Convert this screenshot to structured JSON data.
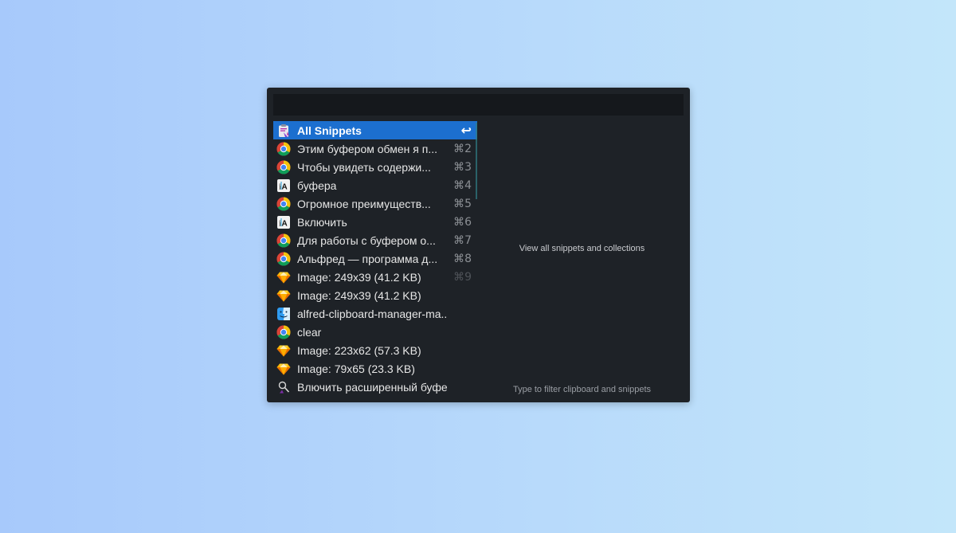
{
  "search": {
    "value": "",
    "placeholder": ""
  },
  "results": [
    {
      "label": "All Snippets",
      "shortcut": "↩",
      "icon": "snippets-clipboard-icon",
      "selected": true
    },
    {
      "label": "Этим буфером обмен я п...",
      "shortcut": "⌘2",
      "icon": "chrome-icon"
    },
    {
      "label": "Чтобы увидеть содержи...",
      "shortcut": "⌘3",
      "icon": "chrome-icon"
    },
    {
      "label": "буфера",
      "shortcut": "⌘4",
      "icon": "ia-writer-icon"
    },
    {
      "label": "Огромное преимуществ...",
      "shortcut": "⌘5",
      "icon": "chrome-icon"
    },
    {
      "label": "Включить",
      "shortcut": "⌘6",
      "icon": "ia-writer-icon"
    },
    {
      "label": "Для работы с буфером о...",
      "shortcut": "⌘7",
      "icon": "chrome-icon"
    },
    {
      "label": "Альфред — программа д...",
      "shortcut": "⌘8",
      "icon": "chrome-icon"
    },
    {
      "label": "Image: 249x39 (41.2 KB)",
      "shortcut": "⌘9",
      "icon": "sketch-icon"
    },
    {
      "label": "Image: 249x39 (41.2 KB)",
      "shortcut": "",
      "icon": "sketch-icon"
    },
    {
      "label": "alfred-clipboard-manager-ma...",
      "shortcut": "",
      "icon": "finder-icon"
    },
    {
      "label": "clear",
      "shortcut": "",
      "icon": "chrome-icon"
    },
    {
      "label": "Image: 223x62 (57.3 KB)",
      "shortcut": "",
      "icon": "sketch-icon"
    },
    {
      "label": "Image: 79x65 (23.3 KB)",
      "shortcut": "",
      "icon": "sketch-icon"
    },
    {
      "label": "Влючить расширенный буфе...",
      "shortcut": "",
      "icon": "alfred-hat-icon"
    }
  ],
  "preview": {
    "description": "View all snippets and collections",
    "hint": "Type to filter clipboard and snippets"
  },
  "colors": {
    "window_bg": "#1e2227",
    "search_bg": "#15181c",
    "selection": "#1c6fcf",
    "text": "#e6e6e6"
  }
}
